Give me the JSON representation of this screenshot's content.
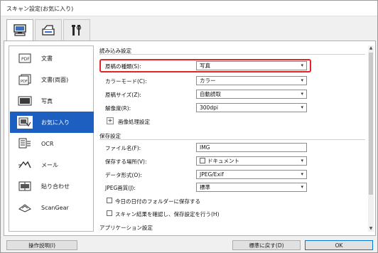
{
  "window": {
    "title": "スキャン設定(お気に入り)"
  },
  "tabs": [
    {
      "name": "scan-from-computer",
      "icon": "computer-icon"
    },
    {
      "name": "scan-from-operation-panel",
      "icon": "scanner-icon"
    },
    {
      "name": "general-settings",
      "icon": "tools-icon"
    }
  ],
  "sidebar": {
    "items": [
      {
        "label": "文書",
        "icon": "document-icon"
      },
      {
        "label": "文書(両面)",
        "icon": "duplex-document-icon"
      },
      {
        "label": "写真",
        "icon": "photo-icon"
      },
      {
        "label": "お気に入り",
        "icon": "favorite-icon",
        "active": true
      },
      {
        "label": "OCR",
        "icon": "ocr-icon"
      },
      {
        "label": "メール",
        "icon": "mail-icon"
      },
      {
        "label": "貼り合わせ",
        "icon": "stitch-icon"
      },
      {
        "label": "ScanGear",
        "icon": "scangear-icon"
      }
    ]
  },
  "scan_options": {
    "title": "読み込み設定",
    "source_label": "原稿の種類(S):",
    "source_value": "写真",
    "color_label": "カラーモード(C):",
    "color_value": "カラー",
    "size_label": "原稿サイズ(Z):",
    "size_value": "自動読取",
    "resolution_label": "解像度(R):",
    "resolution_value": "300dpi",
    "image_processing_label": "画像処理設定"
  },
  "save_settings": {
    "title": "保存設定",
    "filename_label": "ファイル名(F):",
    "filename_value": "IMG",
    "save_in_label": "保存する場所(V):",
    "save_in_value": "ドキュメント",
    "format_label": "データ形式(O):",
    "format_value": "JPEG/Exif",
    "jpeg_label": "JPEG画質(J):",
    "jpeg_value": "標準",
    "subfolder_label": "今日の日付のフォルダーに保存する",
    "confirm_label": "スキャン結果を確認し、保存設定を行う(H)"
  },
  "app_settings": {
    "title": "アプリケーション設定"
  },
  "buttons": {
    "instructions": "操作説明(I)",
    "defaults": "標準に戻す(D)",
    "ok": "OK"
  },
  "colors": {
    "accent": "#1d5fc1",
    "highlight": "#e0252b"
  }
}
